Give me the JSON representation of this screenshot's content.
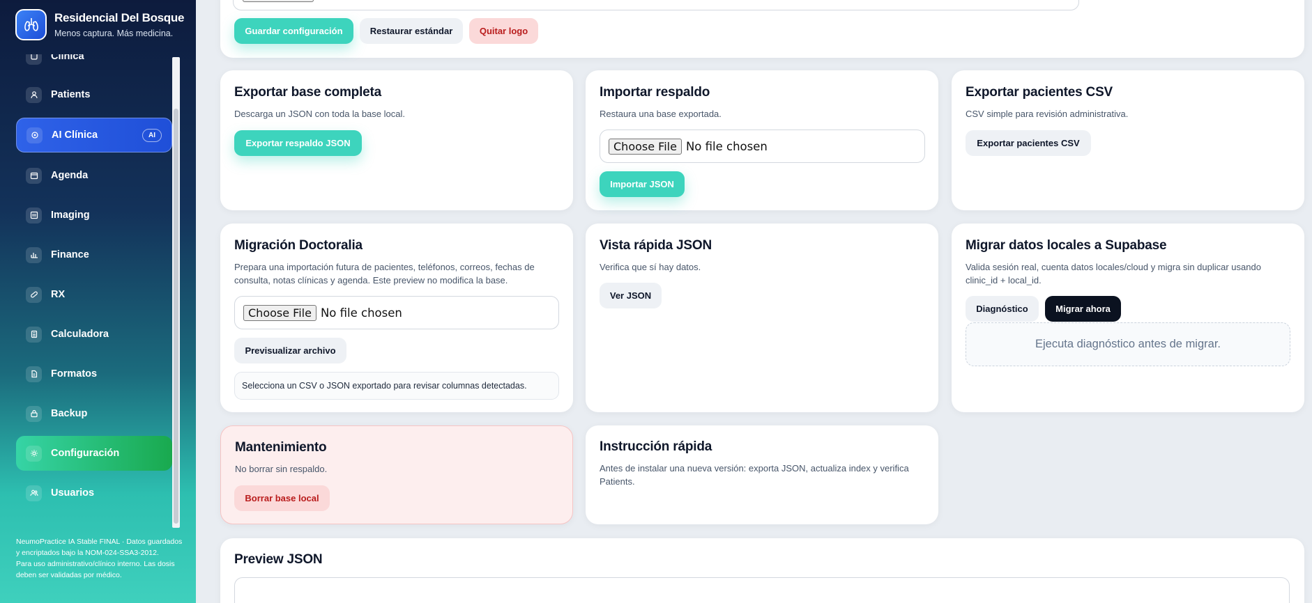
{
  "brand": {
    "title": "Residencial Del Bosque",
    "subtitle": "Menos captura. Más medicina."
  },
  "sidebar": {
    "items": [
      {
        "label": "Clínica",
        "icon": "clinic-icon"
      },
      {
        "label": "Patients",
        "icon": "patient-icon"
      },
      {
        "label": "AI Clínica",
        "icon": "ai-icon",
        "badge": "AI",
        "active": true
      },
      {
        "label": "Agenda",
        "icon": "calendar-icon"
      },
      {
        "label": "Imaging",
        "icon": "image-icon"
      },
      {
        "label": "Finance",
        "icon": "finance-icon"
      },
      {
        "label": "RX",
        "icon": "pill-icon"
      },
      {
        "label": "Calculadora",
        "icon": "calculator-icon"
      },
      {
        "label": "Formatos",
        "icon": "document-icon"
      },
      {
        "label": "Backup",
        "icon": "backup-icon"
      },
      {
        "label": "Configuración",
        "icon": "gear-icon",
        "active": true
      },
      {
        "label": "Usuarios",
        "icon": "users-icon"
      }
    ],
    "footer_line1": "NeumoPractice IA Stable FINAL · Datos guardados y encriptados bajo la NOM-024-SSA3-2012.",
    "footer_line2": "Para uso administrativo/clínico interno. Las dosis deben ser validadas por médico."
  },
  "top": {
    "save": "Guardar configuración",
    "restore": "Restaurar estándar",
    "remove_logo": "Quitar logo"
  },
  "export_full": {
    "title": "Exportar base completa",
    "desc": "Descarga un JSON con toda la base local.",
    "button": "Exportar respaldo JSON"
  },
  "import_backup": {
    "title": "Importar respaldo",
    "desc": "Restaura una base exportada.",
    "choose": "Choose File",
    "no_file": "No file chosen",
    "button": "Importar JSON"
  },
  "export_csv": {
    "title": "Exportar pacientes CSV",
    "desc": "CSV simple para revisión administrativa.",
    "button": "Exportar pacientes CSV"
  },
  "doctoralia": {
    "title": "Migración Doctoralia",
    "desc": "Prepara una importación futura de pacientes, teléfonos, correos, fechas de consulta, notas clínicas y agenda. Este preview no modifica la base.",
    "choose": "Choose File",
    "no_file": "No file chosen",
    "button": "Previsualizar archivo",
    "info": "Selecciona un CSV o JSON exportado para revisar columnas detectadas."
  },
  "quick_view": {
    "title": "Vista rápida JSON",
    "desc": "Verifica que sí hay datos.",
    "button": "Ver JSON"
  },
  "supabase": {
    "title": "Migrar datos locales a Supabase",
    "desc": "Valida sesión real, cuenta datos locales/cloud y migra sin duplicar usando clinic_id + local_id.",
    "diag": "Diagnóstico",
    "migrate": "Migrar ahora",
    "status": "Ejecuta diagnóstico antes de migrar."
  },
  "maintenance": {
    "title": "Mantenimiento",
    "desc": "No borrar sin respaldo.",
    "button": "Borrar base local"
  },
  "quick_instr": {
    "title": "Instrucción rápida",
    "desc": "Antes de instalar una nueva versión: exporta JSON, actualiza index y verifica Patients."
  },
  "preview": {
    "title": "Preview JSON"
  },
  "colors": {
    "teal": "#3dd4bd",
    "blue": "#2f62e8",
    "green": "#19a94e",
    "danger": "#b91c1c"
  }
}
